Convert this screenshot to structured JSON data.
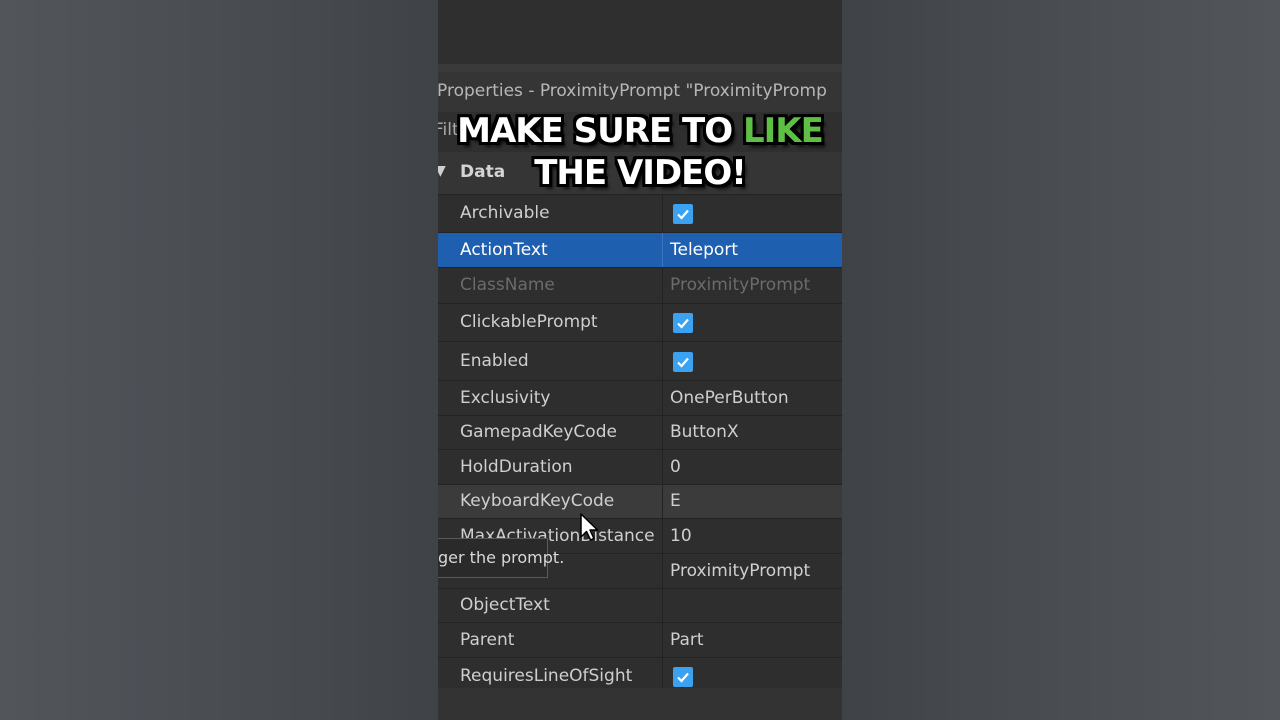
{
  "window": {
    "title": "Properties - ProximityPrompt \"ProximityPromp",
    "filter_label": "Filter"
  },
  "section": {
    "label": "Data"
  },
  "properties": [
    {
      "name": "Archivable",
      "checked": true
    },
    {
      "name": "ActionText",
      "value": "Teleport",
      "selected": true
    },
    {
      "name": "ClassName",
      "value": "ProximityPrompt",
      "disabled": true
    },
    {
      "name": "ClickablePrompt",
      "checked": true
    },
    {
      "name": "Enabled",
      "checked": true
    },
    {
      "name": "Exclusivity",
      "value": "OnePerButton"
    },
    {
      "name": "GamepadKeyCode",
      "value": "ButtonX"
    },
    {
      "name": "HoldDuration",
      "value": "0"
    },
    {
      "name": "KeyboardKeyCode",
      "value": "E",
      "hover": true
    },
    {
      "name": "MaxActivationDistance",
      "value": "10"
    },
    {
      "name": "",
      "value": "ProximityPrompt"
    },
    {
      "name": "ObjectText",
      "value": ""
    },
    {
      "name": "Parent",
      "value": "Part"
    },
    {
      "name": "RequiresLineOfSight",
      "checked": true
    }
  ],
  "tooltip": {
    "text": "ger the prompt."
  },
  "overlay": {
    "line1_prefix": "MAKE SURE TO",
    "line1_highlight": "LIKE",
    "line2": "THE VIDEO!",
    "highlight_color": "#5fbf44"
  },
  "colors": {
    "selected_row": "#1f5fb0",
    "checkbox": "#3aa2f0"
  }
}
